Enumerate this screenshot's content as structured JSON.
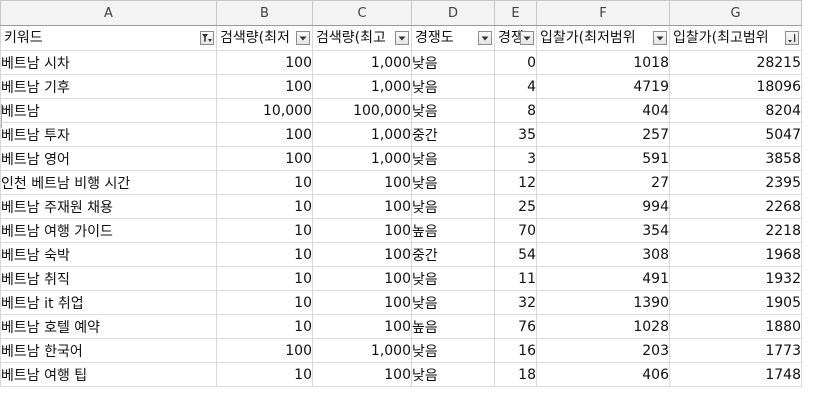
{
  "columns": [
    "A",
    "B",
    "C",
    "D",
    "E",
    "F",
    "G"
  ],
  "headers": [
    {
      "label": "키워드",
      "filter": "filter-active-icon"
    },
    {
      "label": "검색량(최저",
      "filter": "dropdown-icon"
    },
    {
      "label": "검색량(최고",
      "filter": "dropdown-icon"
    },
    {
      "label": "경쟁도",
      "filter": "dropdown-icon"
    },
    {
      "label": "경쟁",
      "filter": "dropdown-icon"
    },
    {
      "label": "입찰가(최저범위",
      "filter": "dropdown-icon"
    },
    {
      "label": "입찰가(최고범위",
      "filter": "sort-desc-icon"
    }
  ],
  "rows": [
    [
      "베트남 시차",
      "100",
      "1,000",
      "낮음",
      "0",
      "1018",
      "28215"
    ],
    [
      "베트남 기후",
      "100",
      "1,000",
      "낮음",
      "4",
      "4719",
      "18096"
    ],
    [
      "베트남",
      "10,000",
      "100,000",
      "낮음",
      "8",
      "404",
      "8204"
    ],
    [
      "베트남 투자",
      "100",
      "1,000",
      "중간",
      "35",
      "257",
      "5047"
    ],
    [
      "베트남 영어",
      "100",
      "1,000",
      "낮음",
      "3",
      "591",
      "3858"
    ],
    [
      "인천 베트남 비행 시간",
      "10",
      "100",
      "낮음",
      "12",
      "27",
      "2395"
    ],
    [
      "베트남 주재원 채용",
      "10",
      "100",
      "낮음",
      "25",
      "994",
      "2268"
    ],
    [
      "베트남 여행 가이드",
      "10",
      "100",
      "높음",
      "70",
      "354",
      "2218"
    ],
    [
      "베트남 숙박",
      "10",
      "100",
      "중간",
      "54",
      "308",
      "1968"
    ],
    [
      "베트남 취직",
      "10",
      "100",
      "낮음",
      "11",
      "491",
      "1932"
    ],
    [
      "베트남 it 취업",
      "10",
      "100",
      "낮음",
      "32",
      "1390",
      "1905"
    ],
    [
      "베트남 호텔 예약",
      "10",
      "100",
      "높음",
      "76",
      "1028",
      "1880"
    ],
    [
      "베트남 한국어",
      "100",
      "1,000",
      "낮음",
      "16",
      "203",
      "1773"
    ],
    [
      "베트남 여행 팁",
      "10",
      "100",
      "낮음",
      "18",
      "406",
      "1748"
    ]
  ]
}
